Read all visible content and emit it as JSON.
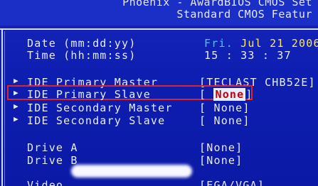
{
  "header": {
    "line1": "Phoenix - AwardBIOS CMOS Set",
    "line2": "Standard CMOS Featur"
  },
  "date_row": {
    "label": "Date (mm:dd:yy)",
    "day": "Fri",
    "date": "Jul 21 2006"
  },
  "time_row": {
    "label": "Time (hh:mm:ss)",
    "time": "15 : 33 : 37"
  },
  "ide": [
    {
      "label": "IDE Primary Master",
      "value": "[TECLAST CHB52E]"
    },
    {
      "label": "IDE Primary Slave",
      "value_open": "[",
      "value": "None",
      "value_close": "]"
    },
    {
      "label": "IDE Secondary Master",
      "value": "[ None]"
    },
    {
      "label": "IDE Secondary Slave",
      "value": "[ None]"
    }
  ],
  "drives": [
    {
      "label": "Drive A",
      "value": "[None]"
    },
    {
      "label": "Drive B",
      "value": "[None]"
    }
  ],
  "video": {
    "label": "Video",
    "value": "[EGA/VGA]"
  },
  "colors": {
    "background": "#0e1eb0",
    "text": "#e9ecff",
    "highlight_value": "#c40000",
    "highlight_box": "#d8262e",
    "day_color": "#4fc3ff",
    "date_color": "#ffe46a"
  },
  "icons": {
    "submenu_arrow": "triangle-right-icon"
  }
}
